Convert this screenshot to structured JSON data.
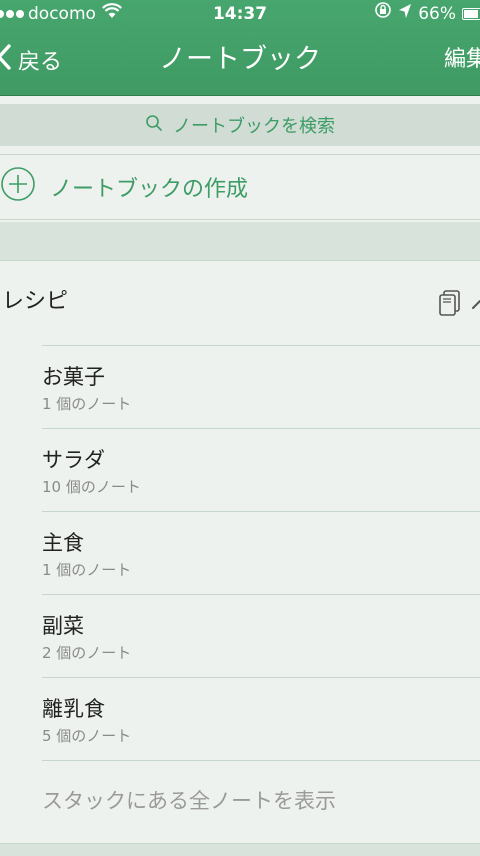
{
  "status_bar": {
    "carrier": "docomo",
    "time": "14:37",
    "battery": "66%",
    "battery_level": 0.66
  },
  "nav": {
    "back_label": "戻る",
    "title": "ノートブック",
    "edit_label": "編集"
  },
  "search": {
    "placeholder": "ノートブックを検索"
  },
  "create": {
    "label": "ノートブックの作成"
  },
  "stack": {
    "name": "レシピ"
  },
  "notebooks": [
    {
      "name": "お菓子",
      "count": "1 個のノート"
    },
    {
      "name": "サラダ",
      "count": "10 個のノート"
    },
    {
      "name": "主食",
      "count": "1 個のノート"
    },
    {
      "name": "副菜",
      "count": "2 個のノート"
    },
    {
      "name": "離乳食",
      "count": "5 個のノート"
    }
  ],
  "show_all_label": "スタックにある全ノートを表示",
  "colors": {
    "accent": "#3e9c66",
    "header": "#43a16a",
    "background": "#eef2ee"
  }
}
